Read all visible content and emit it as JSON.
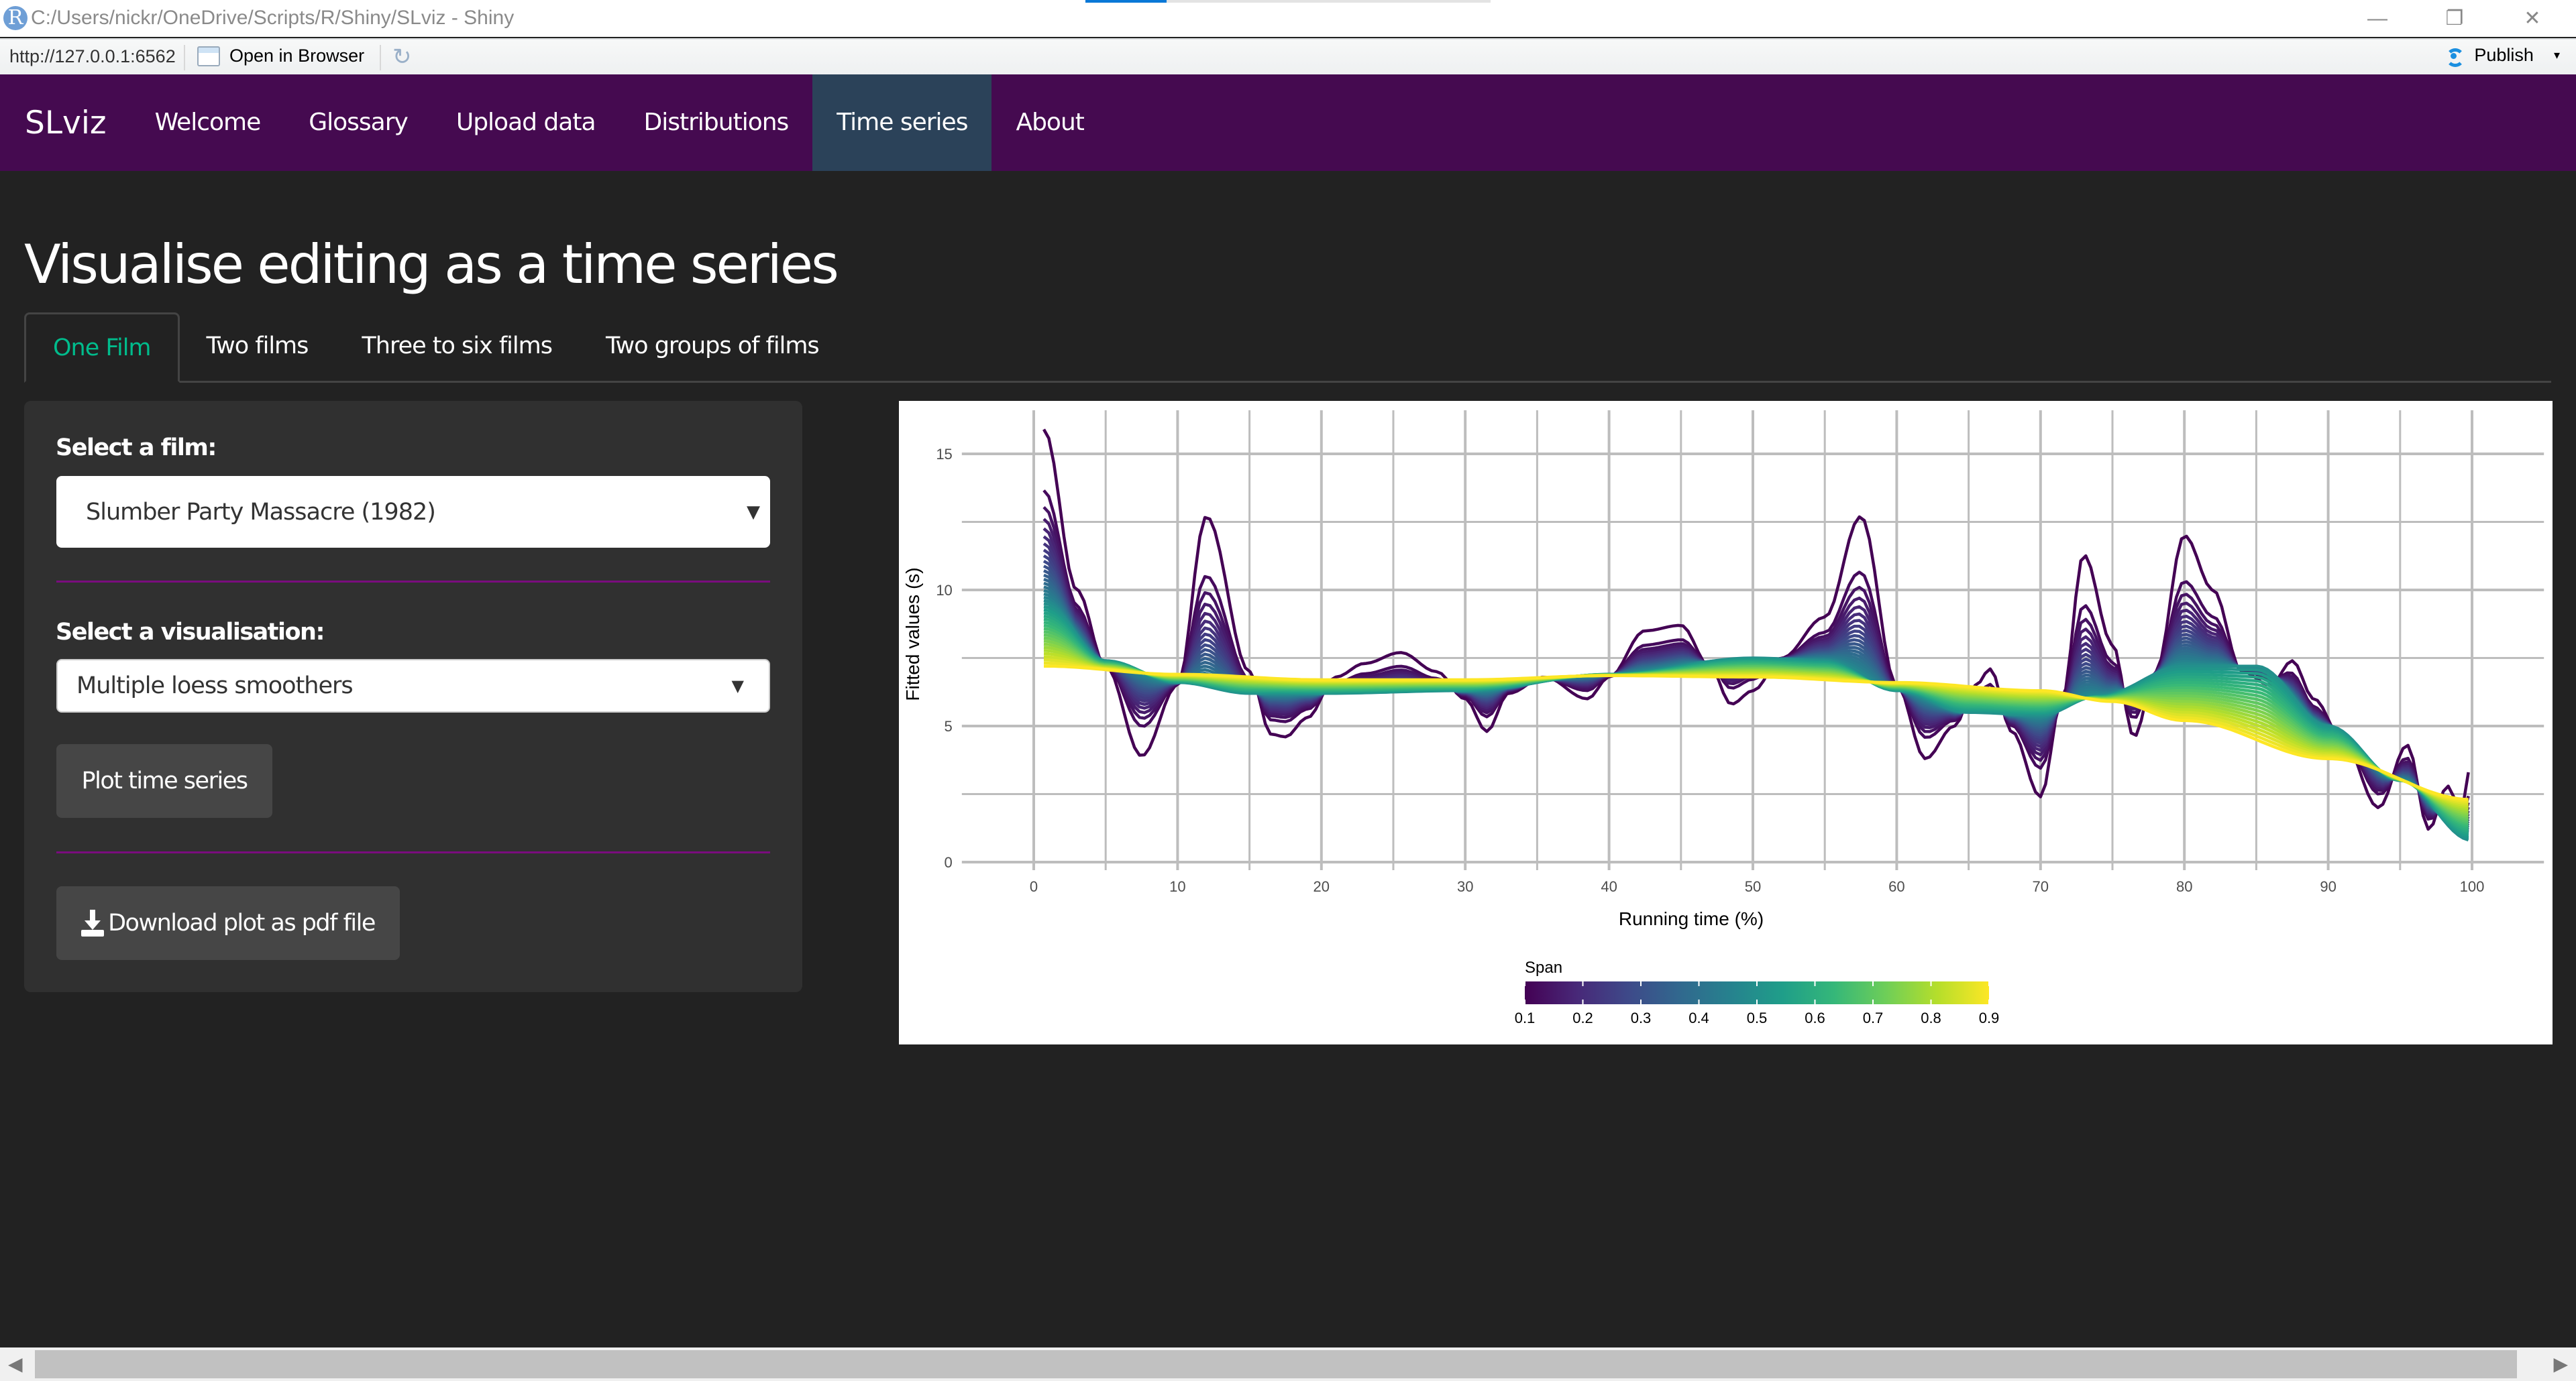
{
  "window": {
    "title": "C:/Users/nickr/OneDrive/Scripts/R/Shiny/SLviz - Shiny",
    "app_icon": "R",
    "loading_progress_percent": 20,
    "controls": {
      "minimize": "—",
      "restore": "❐",
      "close": "✕"
    }
  },
  "toolbar": {
    "url": "http://127.0.0.1:6562",
    "open_in_browser": "Open in Browser",
    "reload_icon": "↻",
    "publish": "Publish",
    "publish_caret": "▾"
  },
  "navbar": {
    "brand": "SLviz",
    "items": [
      {
        "label": "Welcome",
        "active": false
      },
      {
        "label": "Glossary",
        "active": false
      },
      {
        "label": "Upload data",
        "active": false
      },
      {
        "label": "Distributions",
        "active": false
      },
      {
        "label": "Time series",
        "active": true
      },
      {
        "label": "About",
        "active": false
      }
    ]
  },
  "page": {
    "title": "Visualise editing as a time series",
    "tabs": [
      {
        "label": "One Film",
        "active": true
      },
      {
        "label": "Two films",
        "active": false
      },
      {
        "label": "Three to six films",
        "active": false
      },
      {
        "label": "Two groups of films",
        "active": false
      }
    ]
  },
  "sidebar": {
    "film_label": "Select a film:",
    "film_value": "Slumber Party Massacre (1982)",
    "film_caret": "▼",
    "vis_label": "Select a visualisation:",
    "vis_value": "Multiple loess smoothers",
    "vis_caret": "▼",
    "plot_button": "Plot time series",
    "download_button": "Download plot as pdf file"
  },
  "colors": {
    "navbar_bg": "#450a50",
    "navbar_active": "#2b4259",
    "active_tab": "#00bc8c",
    "divider": "#7a0c7e",
    "viridis": [
      "#440154",
      "#482878",
      "#3e4989",
      "#31688e",
      "#26828e",
      "#1f9e89",
      "#35b779",
      "#6ece58",
      "#b5de2b",
      "#fde725"
    ]
  },
  "scrollbar": {
    "left_arrow": "◀",
    "right_arrow": "▶"
  },
  "chart_data": {
    "type": "line",
    "title": "",
    "xlabel": "Running time (%)",
    "ylabel": "Fitted values (s)",
    "xlim": [
      -5,
      105
    ],
    "ylim": [
      -0.5,
      16.5
    ],
    "x_ticks": [
      0,
      10,
      20,
      30,
      40,
      50,
      60,
      70,
      80,
      90,
      100
    ],
    "y_ticks": [
      0,
      5,
      10,
      15
    ],
    "grid": true,
    "legend": {
      "title": "Span",
      "type": "colorbar",
      "placement": "bottom",
      "ticks": [
        "0.1",
        "0.2",
        "0.3",
        "0.4",
        "0.5",
        "0.6",
        "0.7",
        "0.8",
        "0.9"
      ],
      "range": [
        0.1,
        0.9
      ]
    },
    "span_range": [
      0.1,
      0.9
    ],
    "span_step": 0.02,
    "anchor_series": [
      {
        "span": 0.1,
        "x": [
          0.7,
          3,
          5,
          7.5,
          10,
          12,
          15,
          16.5,
          17.5,
          19,
          21,
          23,
          25.5,
          28,
          30,
          31.5,
          33,
          35.5,
          38.5,
          40,
          42.5,
          45,
          47,
          48.5,
          50,
          52,
          55,
          57.5,
          60,
          62,
          64,
          65.5,
          66.5,
          68,
          70,
          71.5,
          73,
          75,
          76.5,
          78,
          80,
          82,
          84,
          86,
          87.5,
          89,
          91,
          93.5,
          95.5,
          97,
          98.3,
          99.2,
          100
        ],
        "y": [
          15.9,
          10,
          7.2,
          3.9,
          6.5,
          12.7,
          7.0,
          4.7,
          4.6,
          5.3,
          6.8,
          7.3,
          7.7,
          7.0,
          6.0,
          4.8,
          6.2,
          6.8,
          6.0,
          6.8,
          8.5,
          8.7,
          7.2,
          5.8,
          6.3,
          7.5,
          9.0,
          12.7,
          6.5,
          3.8,
          5.0,
          6.5,
          7.1,
          4.8,
          2.4,
          6.0,
          11.3,
          8.0,
          4.6,
          7.0,
          12.0,
          10.0,
          7.0,
          6.5,
          7.4,
          6.0,
          4.5,
          2.0,
          4.3,
          1.2,
          2.8,
          1.9,
          3.7
        ]
      },
      {
        "span": 0.5,
        "x": [
          0.7,
          5,
          10,
          15,
          20,
          30,
          40,
          50,
          55,
          60,
          65,
          70,
          74,
          80,
          85,
          90,
          95,
          100
        ],
        "y": [
          9.5,
          7.4,
          6.6,
          6.2,
          6.2,
          6.3,
          6.9,
          7.5,
          7.4,
          6.3,
          5.5,
          5.4,
          6.1,
          7.2,
          7.2,
          5.0,
          3.0,
          0.8
        ]
      },
      {
        "span": 0.9,
        "x": [
          0.7,
          10,
          20,
          30,
          40,
          50,
          60,
          70,
          75,
          80,
          90,
          100
        ],
        "y": [
          7.2,
          6.9,
          6.7,
          6.7,
          6.85,
          6.8,
          6.6,
          6.3,
          5.9,
          5.2,
          3.8,
          2.3
        ]
      }
    ]
  }
}
